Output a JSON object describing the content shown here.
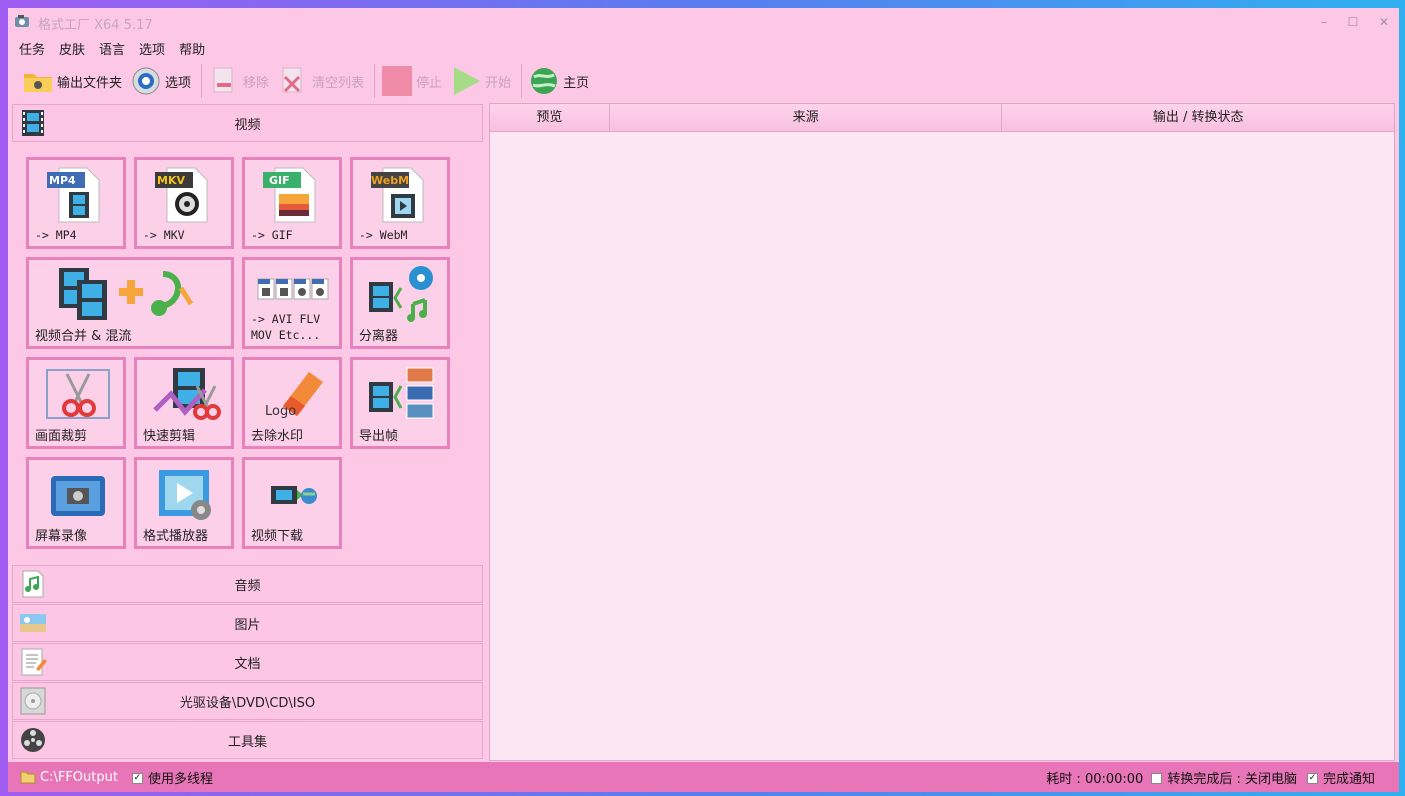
{
  "window": {
    "title": "格式工厂 X64 5.17",
    "minimize": "–",
    "maximize": "☐",
    "close": "✕"
  },
  "menu": [
    "任务",
    "皮肤",
    "语言",
    "选项",
    "帮助"
  ],
  "toolbar": {
    "output_folder": "输出文件夹",
    "options": "选项",
    "remove": "移除",
    "clear_list": "清空列表",
    "stop": "停止",
    "start": "开始",
    "home": "主页"
  },
  "sections": {
    "video": "视频",
    "audio": "音频",
    "image": "图片",
    "document": "文档",
    "disc": "光驱设备\\DVD\\CD\\ISO",
    "tools": "工具集"
  },
  "video_tools": {
    "mp4": {
      "badge": "MP4",
      "label": "-> MP4"
    },
    "mkv": {
      "badge": "MKV",
      "label": "-> MKV"
    },
    "gif": {
      "badge": "GIF",
      "label": "-> GIF"
    },
    "webm": {
      "badge": "WebM",
      "label": "-> WebM"
    },
    "merge": "视频合并 & 混流",
    "other_line1": "-> AVI FLV",
    "other_line2": "MOV Etc...",
    "splitter": "分离器",
    "crop": "画面裁剪",
    "quick_cut": "快速剪辑",
    "logo": "Logo",
    "remove_watermark": "去除水印",
    "export_frames": "导出帧",
    "screen_record": "屏幕录像",
    "player": "格式播放器",
    "download": "视频下载"
  },
  "table": {
    "headers": [
      "预览",
      "来源",
      "输出 / 转换状态"
    ]
  },
  "status": {
    "path": "C:\\FFOutput",
    "multithread": "使用多线程",
    "multithread_checked": true,
    "elapsed": "耗时 : 00:00:00",
    "shutdown": "转换完成后 : 关闭电脑",
    "shutdown_checked": false,
    "notify": "完成通知",
    "notify_checked": true
  },
  "colors": {
    "accent": "#e875b8",
    "tile_border": "#e882bd",
    "background": "#fcc8e6"
  }
}
